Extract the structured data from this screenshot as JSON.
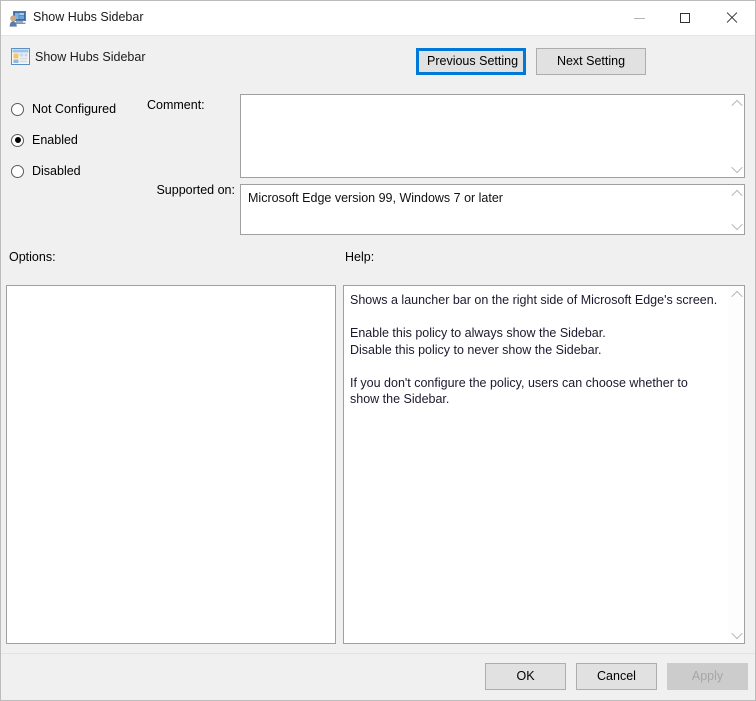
{
  "window": {
    "title": "Show Hubs Sidebar",
    "icon": "policy-setting-icon",
    "caption_buttons": {
      "minimize": "minimize-icon",
      "maximize": "maximize-icon",
      "close": "close-icon"
    }
  },
  "header": {
    "policy_name": "Show Hubs Sidebar",
    "icon": "group-policy-icon",
    "previous_label": "Previous Setting",
    "next_label": "Next Setting"
  },
  "state": {
    "options": [
      {
        "label": "Not Configured",
        "selected": false
      },
      {
        "label": "Enabled",
        "selected": true
      },
      {
        "label": "Disabled",
        "selected": false
      }
    ]
  },
  "fields": {
    "comment_label": "Comment:",
    "comment_value": "",
    "supported_label": "Supported on:",
    "supported_value": "Microsoft Edge version 99, Windows 7 or later",
    "options_label": "Options:",
    "options_value": "",
    "help_label": "Help:",
    "help_value": "Shows a launcher bar on the right side of Microsoft Edge's screen.\n\nEnable this policy to always show the Sidebar.\nDisable this policy to never show the Sidebar.\n\nIf you don't configure the policy, users can choose whether to show the Sidebar."
  },
  "footer": {
    "ok_label": "OK",
    "cancel_label": "Cancel",
    "apply_label": "Apply",
    "apply_enabled": false
  },
  "colors": {
    "dialog_background": "#f0f0f0",
    "titlebar_background": "#ffffff",
    "focus_accent": "#0078d7",
    "button_face": "#e1e1e1",
    "button_border": "#adadad",
    "field_border": "#a0a0a0",
    "disabled_text": "#a6a6a6"
  }
}
